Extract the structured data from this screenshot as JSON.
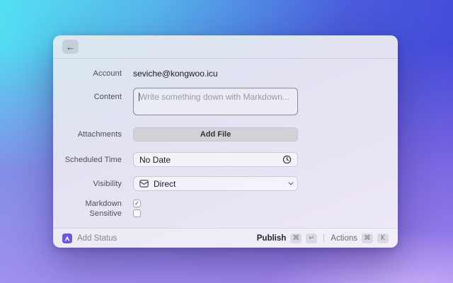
{
  "window": {
    "titlebar": {
      "back_icon": "←"
    },
    "form": {
      "account": {
        "label": "Account",
        "value": "seviche@kongwoo.icu"
      },
      "content": {
        "label": "Content",
        "value": "",
        "placeholder": "Write something down with Markdown..."
      },
      "attachments": {
        "label": "Attachments",
        "add_file_button": "Add File"
      },
      "scheduled_time": {
        "label": "Scheduled Time",
        "value": "No Date"
      },
      "visibility": {
        "label": "Visibility",
        "value": "Direct"
      },
      "markdown": {
        "label": "Markdown",
        "checked": true,
        "check_glyph": "✓"
      },
      "sensitive": {
        "label": "Sensitive",
        "checked": false
      }
    },
    "footer": {
      "app_name": "Add Status",
      "publish_label": "Publish",
      "publish_keys": [
        "⌘",
        "↵"
      ],
      "actions_label": "Actions",
      "actions_keys": [
        "⌘",
        "K"
      ]
    }
  },
  "colors": {
    "accent_purple": "#6c58de",
    "bg_cyan": "#53e0f3",
    "bg_blue": "#3e3ed6",
    "bg_purple": "#a68aee"
  }
}
